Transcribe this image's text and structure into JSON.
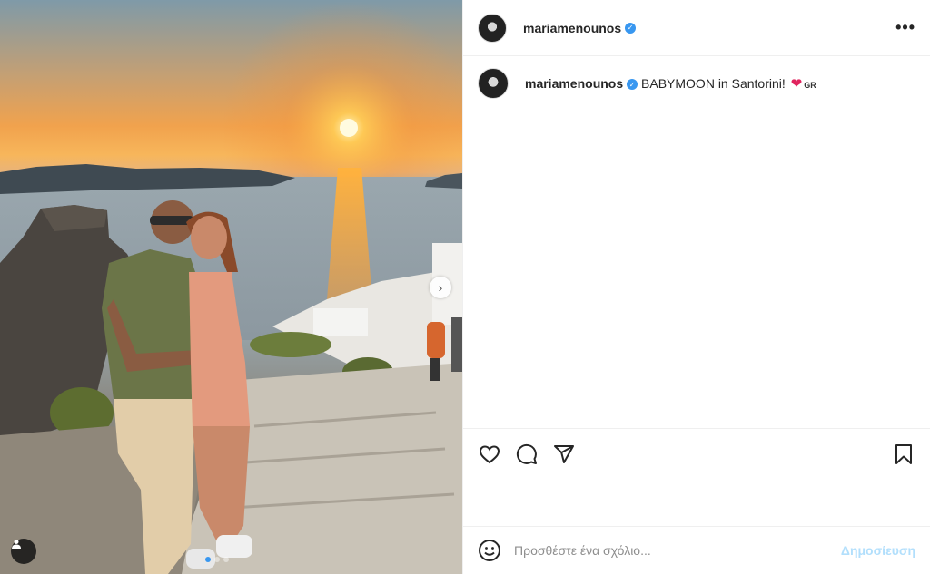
{
  "post": {
    "username": "mariamenounos",
    "verified": true,
    "caption_username": "mariamenounos",
    "caption_text": "BABYMOON in Santorini! ",
    "caption_heart": "❤",
    "caption_flag": "GR",
    "more_symbol": "•••",
    "verified_symbol": "✓"
  },
  "photo": {
    "slide_count": 3,
    "active_slide": 1,
    "next_arrow": "›"
  },
  "actions": {
    "icons": [
      "heart-icon",
      "comment-icon",
      "share-icon",
      "bookmark-icon"
    ]
  },
  "comment": {
    "placeholder": "Προσθέστε ένα σχόλιο...",
    "post_label": "Δημοσίευση"
  },
  "colors": {
    "verified": "#3897f0",
    "post_button": "#b2dffc",
    "heart": "#e0245e"
  }
}
